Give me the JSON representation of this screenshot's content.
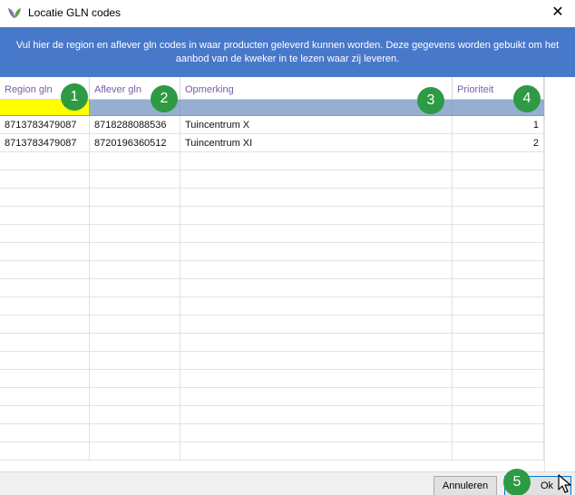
{
  "window": {
    "title": "Locatie GLN codes",
    "close_glyph": "✕"
  },
  "banner": {
    "text": "Vul hier de region en aflever gln codes in waar producten geleverd kunnen worden. Deze gegevens worden gebuikt om het aanbod van de kweker in te lezen waar zij leveren."
  },
  "grid": {
    "columns": [
      "Region gln",
      "Aflever gln",
      "Opmerking",
      "Prioriteit"
    ],
    "rows": [
      {
        "region": "8713783479087",
        "aflever": "8718288088536",
        "opmerking": "Tuincentrum X",
        "prioriteit": "1"
      },
      {
        "region": "8713783479087",
        "aflever": "8720196360512",
        "opmerking": "Tuincentrum XI",
        "prioriteit": "2"
      }
    ]
  },
  "badges": [
    "1",
    "2",
    "3",
    "4",
    "5"
  ],
  "footer": {
    "cancel_label": "Annuleren",
    "ok_label": "Ok"
  },
  "colors": {
    "banner": "#4878c9",
    "header_text": "#7a5ba8",
    "filter_row": "#95afd1",
    "active_filter": "#ffff00",
    "badge": "#2e9a44"
  },
  "icons": {
    "app_logo": "leaf-logo-icon",
    "close": "close-icon",
    "cursor": "mouse-pointer-icon"
  }
}
